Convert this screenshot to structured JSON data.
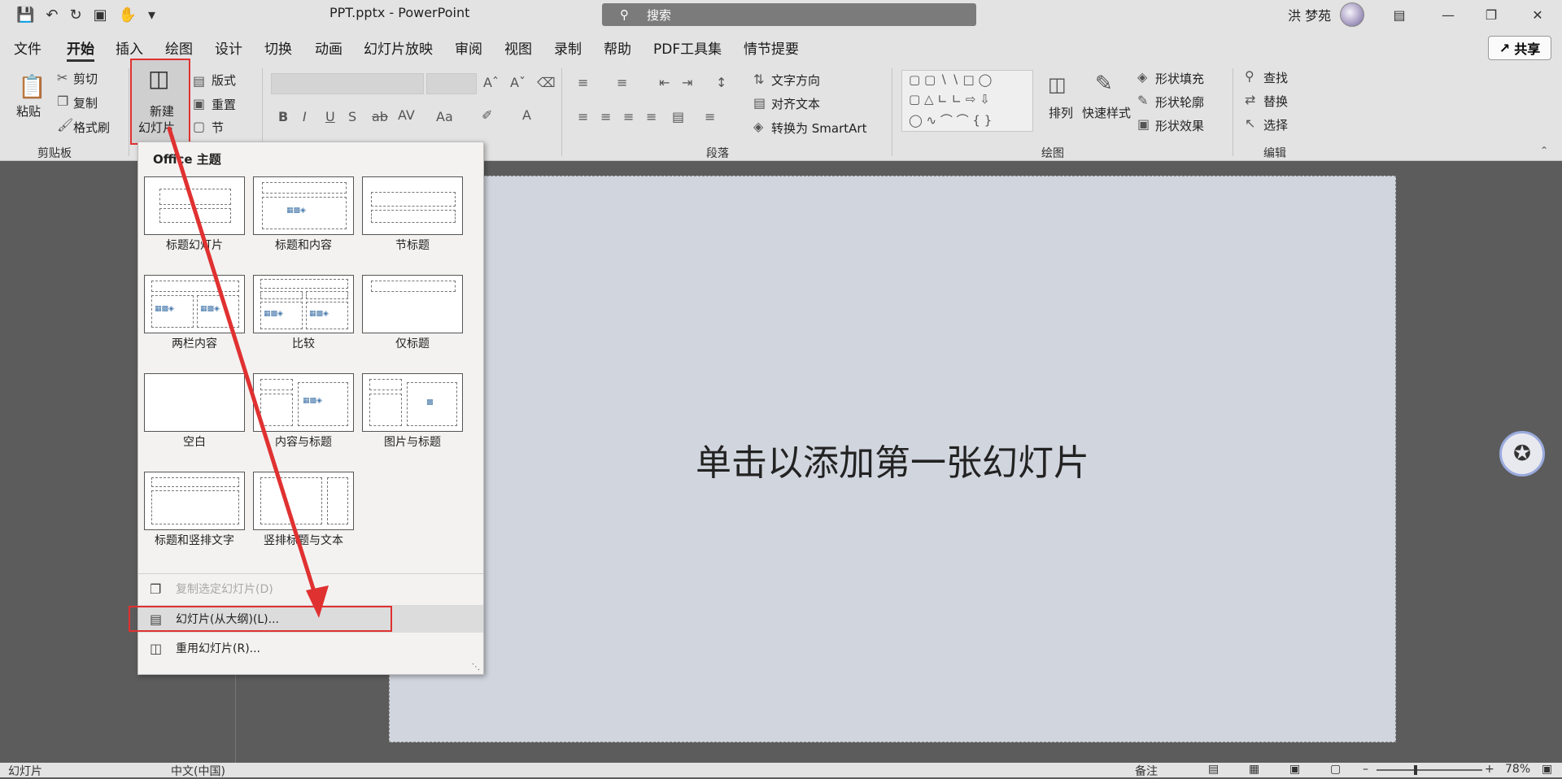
{
  "window": {
    "title": "PPT.pptx  -  PowerPoint",
    "search_placeholder": "搜索",
    "user_name": "洪 梦苑"
  },
  "menu": {
    "tabs": [
      "文件",
      "开始",
      "插入",
      "绘图",
      "设计",
      "切换",
      "动画",
      "幻灯片放映",
      "审阅",
      "视图",
      "录制",
      "帮助",
      "PDF工具集",
      "情节提要"
    ],
    "active": "开始",
    "share_label": "共享"
  },
  "ribbon": {
    "clipboard": {
      "paste": "粘贴",
      "cut": "剪切",
      "copy": "复制",
      "format_painter": "格式刷",
      "group_label": "剪贴板"
    },
    "slides": {
      "new_slide_line1": "新建",
      "new_slide_line2": "幻灯片",
      "layout": "版式",
      "reset": "重置",
      "section": "节"
    },
    "paragraph": {
      "text_direction": "文字方向",
      "align_text": "对齐文本",
      "convert_smartart": "转换为 SmartArt",
      "group_label": "段落"
    },
    "drawing": {
      "arrange": "排列",
      "quick_styles": "快速样式",
      "shape_fill": "形状填充",
      "shape_outline": "形状轮廓",
      "shape_effects": "形状效果",
      "group_label": "绘图"
    },
    "editing": {
      "find": "查找",
      "replace": "替换",
      "select": "选择",
      "group_label": "编辑"
    }
  },
  "dropdown": {
    "title": "Office 主题",
    "layouts": [
      {
        "label": "标题幻灯片"
      },
      {
        "label": "标题和内容"
      },
      {
        "label": "节标题"
      },
      {
        "label": "两栏内容"
      },
      {
        "label": "比较"
      },
      {
        "label": "仅标题"
      },
      {
        "label": "空白"
      },
      {
        "label": "内容与标题"
      },
      {
        "label": "图片与标题"
      },
      {
        "label": "标题和竖排文字"
      },
      {
        "label": "竖排标题与文本"
      }
    ],
    "items": [
      {
        "label": "复制选定幻灯片(D)",
        "disabled": true
      },
      {
        "label": "幻灯片(从大纲)(L)...",
        "disabled": false,
        "highlighted": true
      },
      {
        "label": "重用幻灯片(R)...",
        "disabled": false
      }
    ]
  },
  "slide": {
    "placeholder": "单击以添加第一张幻灯片"
  },
  "statusbar": {
    "slide_label": "幻灯片",
    "language": "中文(中国)",
    "notes": "备注",
    "zoom": "78%"
  },
  "colors": {
    "annotation_red": "#e03131",
    "slide_bg": "#d1d5de",
    "chrome_bg": "#e3e3e3"
  }
}
